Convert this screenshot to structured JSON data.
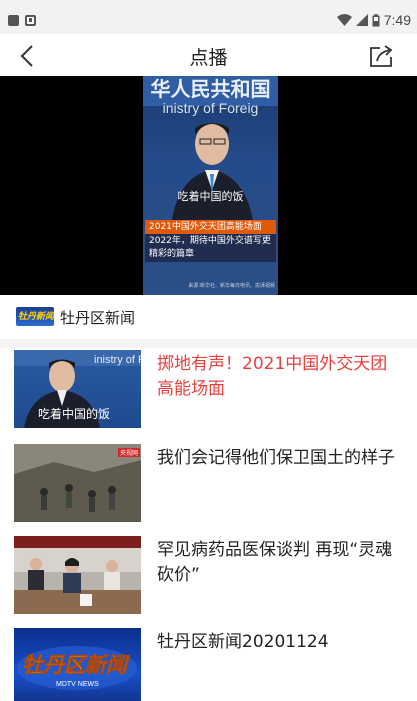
{
  "status_bar": {
    "time": "7:49"
  },
  "header": {
    "title": "点播",
    "back_icon": "back-chevron-icon",
    "share_icon": "share-icon"
  },
  "player": {
    "frame_banner_line1": "华人民共和国",
    "frame_banner_line2": "inistry of Foreig",
    "frame_caption": "吃着中国的饭",
    "frame_lower_title": "2021中国外交天团高能场面",
    "frame_lower_sub": "2022年，期待中国外交谱写更精彩的篇章",
    "frame_credit": "来源:新华社、新华每日电讯、澎湃视频"
  },
  "channel": {
    "logo_text": "牡丹新闻",
    "name": "牡丹区新闻"
  },
  "list": {
    "items": [
      {
        "title": "掷地有声！2021中国外交天团高能场面",
        "active": true,
        "thumb_caption": "吃着中国的饭",
        "thumb_banner": "inistry of Foreig"
      },
      {
        "title": "我们会记得他们保卫国土的样子",
        "active": false,
        "thumb_tag": "央视网"
      },
      {
        "title": "罕见病药品医保谈判 再现“灵魂砍价”",
        "active": false
      },
      {
        "title": "牡丹区新闻20201124",
        "active": false,
        "thumb_logo": "牡丹区新闻",
        "thumb_sub": "MDTV NEWS"
      }
    ]
  },
  "colors": {
    "active_title": "#e8413d",
    "text": "#222222",
    "video_bg": "#000000"
  }
}
